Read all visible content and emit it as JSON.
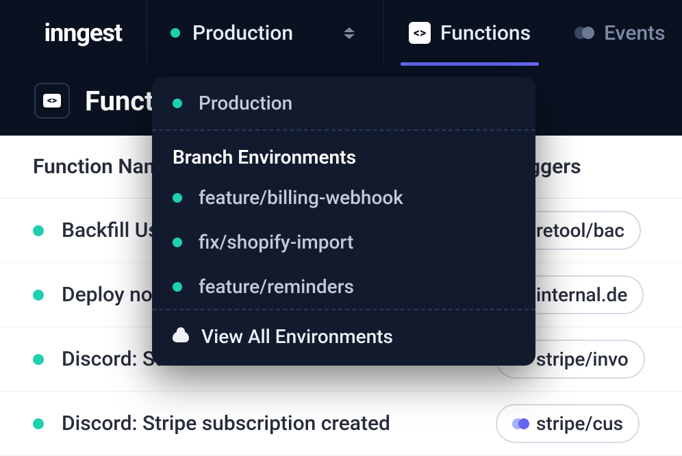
{
  "header": {
    "logo": "inngest",
    "env_selector": {
      "label": "Production"
    },
    "tabs": {
      "functions": "Functions",
      "events": "Events"
    }
  },
  "subheader": {
    "title": "Funct"
  },
  "table": {
    "columns": {
      "name": "Function Name",
      "triggers": "Triggers"
    },
    "rows": [
      {
        "name": "Backfill Use",
        "trigger": "retool/bac"
      },
      {
        "name": "Deploy noti",
        "trigger": "internal.de"
      },
      {
        "name": "Discord: St",
        "trigger": "stripe/invo"
      },
      {
        "name": "Discord: Stripe subscription created",
        "trigger": "stripe/cus"
      }
    ]
  },
  "dropdown": {
    "production": "Production",
    "section_title": "Branch Environments",
    "branches": [
      {
        "label": "feature/billing-webhook"
      },
      {
        "label": "fix/shopify-import"
      },
      {
        "label": "feature/reminders"
      }
    ],
    "footer": "View All Environments"
  }
}
